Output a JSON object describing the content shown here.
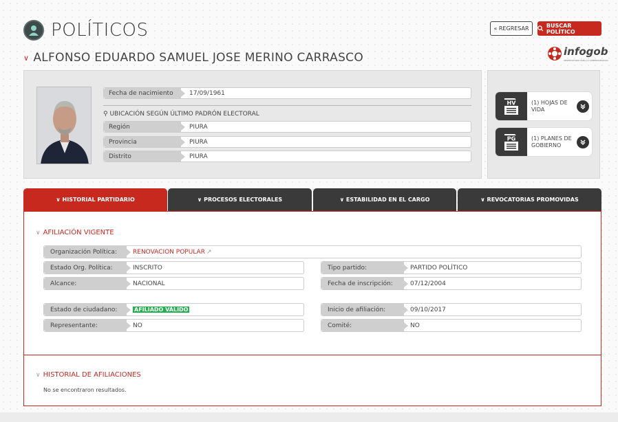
{
  "header": {
    "title": "POLÍTICOS",
    "back_label": "« REGRESAR",
    "search_label": "BUSCAR POLÍTICO"
  },
  "person": {
    "name": "ALFONSO EDUARDO SAMUEL JOSE MERINO CARRASCO"
  },
  "logo": {
    "text": "infogob",
    "subtitle": "OBSERVATORIO PARA LA GOBERNABILIDAD"
  },
  "profile": {
    "birth_label": "Fecha de nacimiento",
    "birth_value": "17/09/1961",
    "location_heading": "UBICACIÓN SEGÚN ÚLTIMO PADRÓN ELECTORAL",
    "region_label": "Región",
    "region_value": "PIURA",
    "province_label": "Provincia",
    "province_value": "PIURA",
    "district_label": "Distrito",
    "district_value": "PIURA"
  },
  "documents": [
    {
      "icon": "HV",
      "label": "(1) HOJAS DE VIDA"
    },
    {
      "icon": "PG",
      "label": "(1) PLANES DE GOBIERNO"
    }
  ],
  "tabs": [
    {
      "label": "HISTORIAL PARTIDARIO",
      "active": true
    },
    {
      "label": "PROCESOS ELECTORALES",
      "active": false
    },
    {
      "label": "ESTABILIDAD EN EL CARGO",
      "active": false
    },
    {
      "label": "REVOCATORIAS PROMOVIDAS",
      "active": false
    }
  ],
  "affiliation": {
    "title": "AFILIACIÓN VIGENTE",
    "org_label": "Organización Política:",
    "org_value": "RENOVACION POPULAR",
    "state_org_label": "Estado Org. Política:",
    "state_org_value": "INSCRITO",
    "party_type_label": "Tipo partido:",
    "party_type_value": "PARTIDO POLÍTICO",
    "scope_label": "Alcance:",
    "scope_value": "NACIONAL",
    "reg_date_label": "Fecha de inscripción:",
    "reg_date_value": "07/12/2004",
    "citizen_state_label": "Estado de ciudadano:",
    "citizen_state_value": "AFILIADO VÁLIDO",
    "start_label": "Inicio de afiliación:",
    "start_value": "09/10/2017",
    "rep_label": "Representante:",
    "rep_value": "NO",
    "committee_label": "Comité:",
    "committee_value": "NO"
  },
  "history": {
    "title": "HISTORIAL DE AFILIACIONES",
    "empty_text": "No se encontraron resultados."
  },
  "colors": {
    "accent": "#c8291f",
    "dark_tab": "#3a3a3a",
    "valid_badge": "#22b14c"
  }
}
